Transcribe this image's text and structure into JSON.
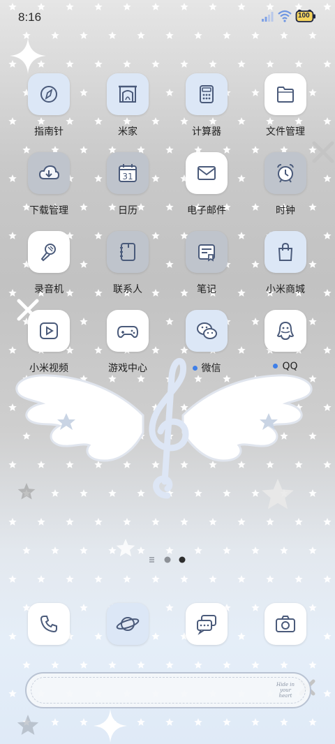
{
  "status_bar": {
    "time": "8:16",
    "battery": "100"
  },
  "apps": [
    {
      "label": "指南针",
      "icon": "compass-icon",
      "bg": "blue"
    },
    {
      "label": "米家",
      "icon": "fireplace-icon",
      "bg": "blue"
    },
    {
      "label": "计算器",
      "icon": "calculator-icon",
      "bg": "blue"
    },
    {
      "label": "文件管理",
      "icon": "folder-icon",
      "bg": "white"
    },
    {
      "label": "下载管理",
      "icon": "download-cloud-icon",
      "bg": "grey"
    },
    {
      "label": "日历",
      "icon": "calendar-icon",
      "bg": "grey",
      "day": "31"
    },
    {
      "label": "电子邮件",
      "icon": "mail-icon",
      "bg": "white"
    },
    {
      "label": "时钟",
      "icon": "alarm-clock-icon",
      "bg": "grey"
    },
    {
      "label": "录音机",
      "icon": "microphone-icon",
      "bg": "white"
    },
    {
      "label": "联系人",
      "icon": "contacts-book-icon",
      "bg": "grey"
    },
    {
      "label": "笔记",
      "icon": "notes-icon",
      "bg": "grey"
    },
    {
      "label": "小米商城",
      "icon": "shopping-bag-icon",
      "bg": "blue"
    },
    {
      "label": "小米视频",
      "icon": "video-play-icon",
      "bg": "white"
    },
    {
      "label": "游戏中心",
      "icon": "gamepad-icon",
      "bg": "white"
    },
    {
      "label": "微信",
      "icon": "wechat-icon",
      "bg": "blue",
      "notification_dot": true
    },
    {
      "label": "QQ",
      "icon": "qq-penguin-icon",
      "bg": "white",
      "notification_dot": true
    }
  ],
  "dock": [
    {
      "icon": "phone-icon"
    },
    {
      "icon": "browser-planet-icon"
    },
    {
      "icon": "messages-icon"
    },
    {
      "icon": "camera-icon"
    }
  ],
  "search_bar": {
    "text": "Hide in your heart"
  },
  "page_indicator": {
    "pages": 2,
    "current": 2
  },
  "colors": {
    "icon_stroke": "#4a5a7a",
    "accent_dot": "#3f7fe8",
    "wallpaper_star": "#ffffff"
  }
}
